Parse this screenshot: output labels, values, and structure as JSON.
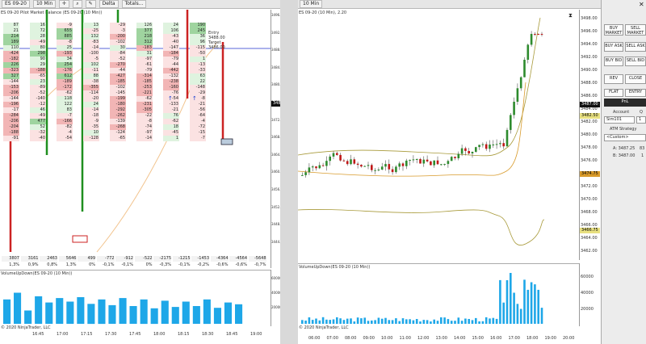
{
  "left_chart": {
    "toolbar": {
      "instrument": "ES 09-20",
      "interval": "10 Min",
      "study": "Delta",
      "totals": "Totals..."
    },
    "title": "ES 09-20  Pilot Market Balance (ES 09-20 (10 Min))",
    "y_ticks": [
      "3496.00",
      "3494.00",
      "3492.00",
      "3490.00",
      "3488.00",
      "3486.00",
      "3484.00",
      "3482.00",
      "3480.00",
      "3478.00",
      "3476.00",
      "3474.00",
      "3472.00",
      "3470.00",
      "3468.00",
      "3466.00",
      "3464.00",
      "3462.00",
      "3460.00",
      "3458.00",
      "3456.00",
      "3454.00",
      "3452.00",
      "3450.00",
      "3448.00",
      "3446.00",
      "3444.00",
      "3442.00"
    ],
    "price_tag": "3487.00",
    "entry_label": {
      "line1": "Entry",
      "line2": "3488.00",
      "line3": "Target",
      "line4": "3486.00"
    },
    "columns": [
      {
        "cells": [
          "87",
          "21",
          "214",
          "189",
          "110",
          "-424",
          "-182",
          "226",
          "-323",
          "327",
          "-144",
          "-153",
          "-206",
          "-144",
          "-196",
          "-17",
          "-284",
          "-206",
          "-204",
          "-188",
          "-91"
        ]
      },
      {
        "cells": [
          "16",
          "72",
          "28",
          "-49",
          "80",
          "298",
          "90",
          "29",
          "-188",
          "-65",
          "23",
          "-89",
          "-52",
          "-140",
          "-12",
          "46",
          "-49",
          "477",
          "52",
          "-32",
          "-40"
        ]
      },
      {
        "cells": [
          "-9",
          "655",
          "885",
          "-8",
          "25",
          "-193",
          "34",
          "254",
          "-176",
          "612",
          "-189",
          "-172",
          "-62",
          "118",
          "122",
          "83",
          "-7",
          "-166",
          "-82",
          "-4",
          "-54"
        ]
      },
      {
        "cells": [
          "13",
          "-25",
          "132",
          "-83",
          "-14",
          "-100",
          "-5",
          "102",
          "-11",
          "88",
          "-38",
          "-355",
          "-114",
          "-20",
          "24",
          "-14",
          "-18",
          "-9",
          "-35",
          "10",
          "-128"
        ]
      },
      {
        "cells": [
          "-29",
          "-3",
          "-200",
          "-102",
          "30",
          "-84",
          "-52",
          "-270",
          "-44",
          "-427",
          "-185",
          "-102",
          "-145",
          "-199",
          "-180",
          "-292",
          "-262",
          "-139",
          "-268",
          "-124",
          "-65"
        ]
      },
      {
        "cells": [
          "126",
          "377",
          "218",
          "312",
          "-183",
          "31",
          "-97",
          "-61",
          "-79",
          "-314",
          "-185",
          "-253",
          "-221",
          "-62",
          "-231",
          "-305",
          "-22",
          "-8",
          "-74",
          "-97",
          "-14"
        ]
      },
      {
        "cells": [
          "24",
          "106",
          "-43",
          "-40",
          "-147",
          "-184",
          "-79",
          "-44",
          "-442",
          "-132",
          "-238",
          "-160",
          "-76",
          "-54",
          "-133",
          "-21",
          "76",
          "-62",
          "18",
          "-45",
          "1"
        ]
      },
      {
        "cells": [
          "190",
          "245",
          "36",
          "96",
          "-115",
          "-50",
          "1",
          "-13",
          "-33",
          "63",
          "22",
          "-148",
          "-29",
          "-8",
          "-21",
          "-56",
          "-64",
          "-4",
          "-72",
          "-15",
          "-7"
        ]
      }
    ],
    "summary_row1": [
      "3807",
      "3161",
      "2463",
      "5646",
      "499",
      "-772",
      "-912",
      "-522",
      "-2175",
      "-1215",
      "-1453",
      "-4364",
      "-4564",
      "-5648"
    ],
    "summary_row2": [
      "1,3%",
      "0,9%",
      "0,8%",
      "1,3%",
      "0%",
      "-0,1%",
      "-0,1%",
      "0%",
      "-0,3%",
      "-0,1%",
      "-0,2%",
      "-0,6%",
      "-0,6%",
      "-0,7%"
    ],
    "indicator_title": "VolumeUpDown(ES 09-20 (10 Min))",
    "indicator_ticks": [
      "60000",
      "40000",
      "20000"
    ],
    "x_ticks": [
      "16:45",
      "17:00",
      "17:15",
      "17:30",
      "17:45",
      "18:00",
      "18:15",
      "18:30",
      "18:45",
      "19:00"
    ],
    "footer": "© 2020 NinjaTrader, LLC",
    "volume_bars": [
      0.55,
      0.7,
      0.3,
      0.62,
      0.48,
      0.58,
      0.5,
      0.6,
      0.45,
      0.55,
      0.42,
      0.58,
      0.4,
      0.55,
      0.35,
      0.52,
      0.38,
      0.5,
      0.4,
      0.55,
      0.36,
      0.48,
      0.44
    ]
  },
  "right_chart": {
    "title": "ES 09-20 (10 Min), 2.20",
    "y_ticks": [
      "3498.00",
      "3496.00",
      "3494.00",
      "3492.00",
      "3490.00",
      "3488.00",
      "3486.00",
      "3484.00",
      "3482.00",
      "3480.00",
      "3478.00",
      "3476.00",
      "3474.00",
      "3472.00",
      "3470.00",
      "3468.00",
      "3466.00",
      "3464.00",
      "3462.00"
    ],
    "price_tags": {
      "last": "3487.00",
      "upper": "3482.50",
      "mid": "3474.75",
      "lower": "3466.75"
    },
    "x_ticks": [
      "06:00",
      "07:00",
      "08:00",
      "09:00",
      "10:00",
      "11:00",
      "12:00",
      "13:00",
      "14:00",
      "15:00",
      "16:00",
      "17:00",
      "18:00",
      "19:00",
      "20:00"
    ],
    "indicator_title": "VolumeUpDown(ES 09-20 (10 Min))",
    "indicator_ticks": [
      "60000",
      "40000",
      "20000"
    ],
    "footer": "© 2020 NinjaTrader, LLC",
    "colors": {
      "up": "#2e8b2e",
      "down": "#c01818",
      "band": "#a89a3a",
      "volume": "#1ea7e8"
    }
  },
  "trade_panel": {
    "buy_market": "BUY MARKET",
    "sell_market": "SELL MARKET",
    "buy_ask": "BUY ASK",
    "sell_ask": "SELL ASK",
    "buy_bid": "BUY BID",
    "sell_bid": "SELL BID",
    "rev": "REV",
    "close": "CLOSE",
    "flat": "FLAT",
    "entry": "ENTRY",
    "pnl": "PnL",
    "account_label": "Account",
    "account_value": "Sim101",
    "qty_label": "Q",
    "qty_value": "1",
    "atm_label": "ATM Strategy",
    "atm_value": "<Custom>",
    "ask_line": "A: 3487.25",
    "ask_qty": "83",
    "bid_line": "B: 3487.00",
    "bid_qty": "1"
  }
}
